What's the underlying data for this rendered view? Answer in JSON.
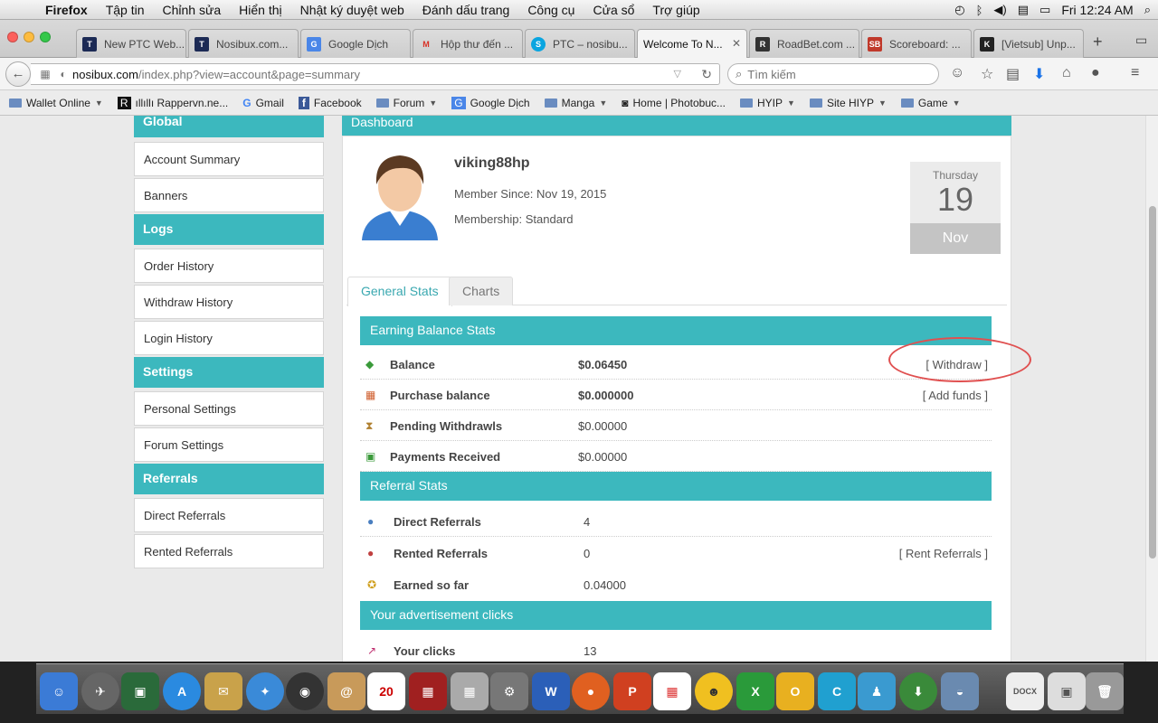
{
  "menubar": {
    "app": "Firefox",
    "items": [
      "Tập tin",
      "Chỉnh sửa",
      "Hiển thị",
      "Nhật ký duyệt web",
      "Đánh dấu trang",
      "Công cụ",
      "Cửa sổ",
      "Trợ giúp"
    ],
    "clock": "Fri 12:24 AM"
  },
  "tabs": [
    {
      "label": "New PTC Web...",
      "icon": "talk-ptc-icon",
      "active": false
    },
    {
      "label": "Nosibux.com...",
      "icon": "talk-ptc-icon",
      "active": false
    },
    {
      "label": "Google Dịch",
      "icon": "google-translate-icon",
      "active": false
    },
    {
      "label": "Hộp thư đến ...",
      "icon": "gmail-icon",
      "active": false
    },
    {
      "label": "PTC – nosibu...",
      "icon": "skype-icon",
      "active": false
    },
    {
      "label": "Welcome To N...",
      "icon": "",
      "active": true
    },
    {
      "label": "RoadBet.com ...",
      "icon": "roadbet-icon",
      "active": false
    },
    {
      "label": "Scoreboard: ...",
      "icon": "sb-icon",
      "active": false
    },
    {
      "label": "[Vietsub] Unp...",
      "icon": "k-icon",
      "active": false
    }
  ],
  "navbar": {
    "url_host": "nosibux.com",
    "url_path": "/index.php?view=account&page=summary",
    "search_placeholder": "Tìm kiếm"
  },
  "bookmarks": [
    {
      "label": "Wallet Online",
      "type": "folder"
    },
    {
      "label": "ıllıllı Rappervn.ne...",
      "type": "link"
    },
    {
      "label": "Gmail",
      "type": "link"
    },
    {
      "label": "Facebook",
      "type": "link"
    },
    {
      "label": "Forum",
      "type": "folder"
    },
    {
      "label": "Google Dịch",
      "type": "link"
    },
    {
      "label": "Manga",
      "type": "folder"
    },
    {
      "label": "Home | Photobuc...",
      "type": "link"
    },
    {
      "label": "HYIP",
      "type": "folder"
    },
    {
      "label": "Site HIYP",
      "type": "folder"
    },
    {
      "label": "Game",
      "type": "folder"
    }
  ],
  "sidebar": {
    "global": "Global",
    "global_items": [
      "Account Summary",
      "Banners"
    ],
    "logs": "Logs",
    "logs_items": [
      "Order History",
      "Withdraw History",
      "Login History"
    ],
    "settings": "Settings",
    "settings_items": [
      "Personal Settings",
      "Forum Settings"
    ],
    "referrals": "Referrals",
    "referrals_items": [
      "Direct Referrals",
      "Rented Referrals"
    ]
  },
  "dashboard": {
    "title": "Dashboard",
    "username": "viking88hp",
    "member_since": "Member Since: Nov 19, 2015",
    "membership": "Membership: Standard",
    "date_dow": "Thursday",
    "date_day": "19",
    "date_month": "Nov",
    "tab_general": "General Stats",
    "tab_charts": "Charts"
  },
  "earning": {
    "header": "Earning Balance Stats",
    "rows": [
      {
        "label": "Balance",
        "value": "$0.06450",
        "action": "[ Withdraw ]"
      },
      {
        "label": "Purchase balance",
        "value": "$0.000000",
        "action": "[ Add funds ]"
      },
      {
        "label": "Pending Withdrawls",
        "value": "$0.00000",
        "action": ""
      },
      {
        "label": "Payments Received",
        "value": "$0.00000",
        "action": ""
      }
    ]
  },
  "referral": {
    "header": "Referral Stats",
    "rows": [
      {
        "label": "Direct Referrals",
        "value": "4",
        "action": ""
      },
      {
        "label": "Rented Referrals",
        "value": "0",
        "action": "[ Rent Referrals ]"
      },
      {
        "label": "Earned so far",
        "value": "0.04000",
        "action": ""
      }
    ]
  },
  "clicks": {
    "header": "Your advertisement clicks",
    "rows": [
      {
        "label": "Your clicks",
        "value": "13"
      }
    ]
  },
  "colors": {
    "accent": "#3cb8be",
    "annotation": "#e05050"
  }
}
